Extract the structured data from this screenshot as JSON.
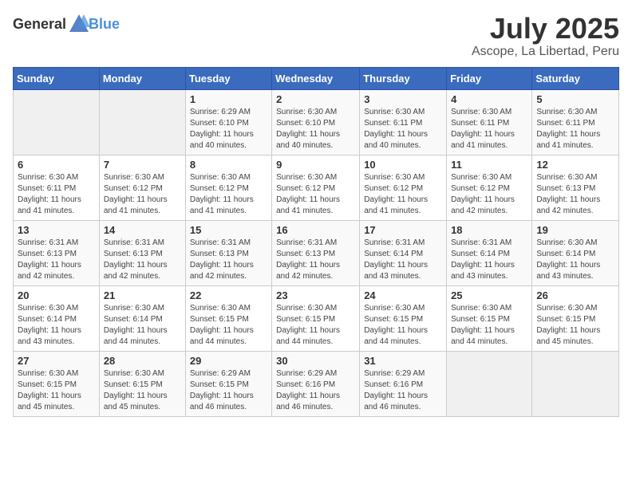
{
  "header": {
    "logo_general": "General",
    "logo_blue": "Blue",
    "month": "July 2025",
    "location": "Ascope, La Libertad, Peru"
  },
  "weekdays": [
    "Sunday",
    "Monday",
    "Tuesday",
    "Wednesday",
    "Thursday",
    "Friday",
    "Saturday"
  ],
  "weeks": [
    [
      {
        "day": "",
        "info": ""
      },
      {
        "day": "",
        "info": ""
      },
      {
        "day": "1",
        "info": "Sunrise: 6:29 AM\nSunset: 6:10 PM\nDaylight: 11 hours and 40 minutes."
      },
      {
        "day": "2",
        "info": "Sunrise: 6:30 AM\nSunset: 6:10 PM\nDaylight: 11 hours and 40 minutes."
      },
      {
        "day": "3",
        "info": "Sunrise: 6:30 AM\nSunset: 6:11 PM\nDaylight: 11 hours and 40 minutes."
      },
      {
        "day": "4",
        "info": "Sunrise: 6:30 AM\nSunset: 6:11 PM\nDaylight: 11 hours and 41 minutes."
      },
      {
        "day": "5",
        "info": "Sunrise: 6:30 AM\nSunset: 6:11 PM\nDaylight: 11 hours and 41 minutes."
      }
    ],
    [
      {
        "day": "6",
        "info": "Sunrise: 6:30 AM\nSunset: 6:11 PM\nDaylight: 11 hours and 41 minutes."
      },
      {
        "day": "7",
        "info": "Sunrise: 6:30 AM\nSunset: 6:12 PM\nDaylight: 11 hours and 41 minutes."
      },
      {
        "day": "8",
        "info": "Sunrise: 6:30 AM\nSunset: 6:12 PM\nDaylight: 11 hours and 41 minutes."
      },
      {
        "day": "9",
        "info": "Sunrise: 6:30 AM\nSunset: 6:12 PM\nDaylight: 11 hours and 41 minutes."
      },
      {
        "day": "10",
        "info": "Sunrise: 6:30 AM\nSunset: 6:12 PM\nDaylight: 11 hours and 41 minutes."
      },
      {
        "day": "11",
        "info": "Sunrise: 6:30 AM\nSunset: 6:12 PM\nDaylight: 11 hours and 42 minutes."
      },
      {
        "day": "12",
        "info": "Sunrise: 6:30 AM\nSunset: 6:13 PM\nDaylight: 11 hours and 42 minutes."
      }
    ],
    [
      {
        "day": "13",
        "info": "Sunrise: 6:31 AM\nSunset: 6:13 PM\nDaylight: 11 hours and 42 minutes."
      },
      {
        "day": "14",
        "info": "Sunrise: 6:31 AM\nSunset: 6:13 PM\nDaylight: 11 hours and 42 minutes."
      },
      {
        "day": "15",
        "info": "Sunrise: 6:31 AM\nSunset: 6:13 PM\nDaylight: 11 hours and 42 minutes."
      },
      {
        "day": "16",
        "info": "Sunrise: 6:31 AM\nSunset: 6:13 PM\nDaylight: 11 hours and 42 minutes."
      },
      {
        "day": "17",
        "info": "Sunrise: 6:31 AM\nSunset: 6:14 PM\nDaylight: 11 hours and 43 minutes."
      },
      {
        "day": "18",
        "info": "Sunrise: 6:31 AM\nSunset: 6:14 PM\nDaylight: 11 hours and 43 minutes."
      },
      {
        "day": "19",
        "info": "Sunrise: 6:30 AM\nSunset: 6:14 PM\nDaylight: 11 hours and 43 minutes."
      }
    ],
    [
      {
        "day": "20",
        "info": "Sunrise: 6:30 AM\nSunset: 6:14 PM\nDaylight: 11 hours and 43 minutes."
      },
      {
        "day": "21",
        "info": "Sunrise: 6:30 AM\nSunset: 6:14 PM\nDaylight: 11 hours and 44 minutes."
      },
      {
        "day": "22",
        "info": "Sunrise: 6:30 AM\nSunset: 6:15 PM\nDaylight: 11 hours and 44 minutes."
      },
      {
        "day": "23",
        "info": "Sunrise: 6:30 AM\nSunset: 6:15 PM\nDaylight: 11 hours and 44 minutes."
      },
      {
        "day": "24",
        "info": "Sunrise: 6:30 AM\nSunset: 6:15 PM\nDaylight: 11 hours and 44 minutes."
      },
      {
        "day": "25",
        "info": "Sunrise: 6:30 AM\nSunset: 6:15 PM\nDaylight: 11 hours and 44 minutes."
      },
      {
        "day": "26",
        "info": "Sunrise: 6:30 AM\nSunset: 6:15 PM\nDaylight: 11 hours and 45 minutes."
      }
    ],
    [
      {
        "day": "27",
        "info": "Sunrise: 6:30 AM\nSunset: 6:15 PM\nDaylight: 11 hours and 45 minutes."
      },
      {
        "day": "28",
        "info": "Sunrise: 6:30 AM\nSunset: 6:15 PM\nDaylight: 11 hours and 45 minutes."
      },
      {
        "day": "29",
        "info": "Sunrise: 6:29 AM\nSunset: 6:15 PM\nDaylight: 11 hours and 46 minutes."
      },
      {
        "day": "30",
        "info": "Sunrise: 6:29 AM\nSunset: 6:16 PM\nDaylight: 11 hours and 46 minutes."
      },
      {
        "day": "31",
        "info": "Sunrise: 6:29 AM\nSunset: 6:16 PM\nDaylight: 11 hours and 46 minutes."
      },
      {
        "day": "",
        "info": ""
      },
      {
        "day": "",
        "info": ""
      }
    ]
  ]
}
